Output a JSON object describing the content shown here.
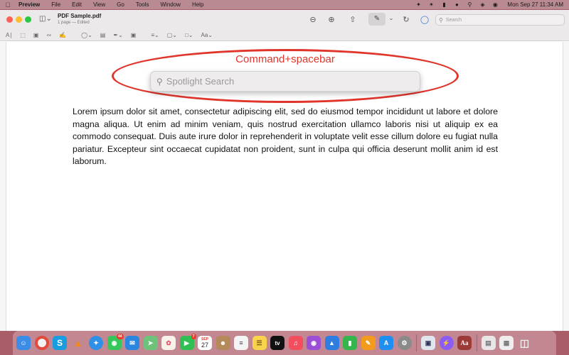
{
  "menubar": {
    "app_name": "Preview",
    "items": [
      "File",
      "Edit",
      "View",
      "Go",
      "Tools",
      "Window",
      "Help"
    ],
    "clock": "Mon Sep 27  11:34 AM"
  },
  "window": {
    "doc_title": "PDF Sample.pdf",
    "doc_subtitle": "1 page — Edited",
    "search_placeholder": "Search"
  },
  "annotation": {
    "label": "Command+spacebar",
    "color": "#e0352b"
  },
  "spotlight": {
    "placeholder": "Spotlight Search"
  },
  "document": {
    "body": "Lorem ipsum dolor sit amet, consectetur adipiscing elit, sed do eiusmod tempor incididunt ut labore et dolore magna aliqua. Ut enim ad minim veniam, quis nostrud exercitation ullamco laboris nisi ut aliquip ex ea commodo consequat. Duis aute irure dolor in reprehenderit in voluptate velit esse cillum dolore eu fugiat nulla pariatur. Excepteur sint occaecat cupidatat non proident, sunt in culpa qui officia deserunt mollit anim id est laborum."
  },
  "dock": {
    "messages_badge": "44",
    "facetime_badge": "7",
    "calendar_month": "SEP",
    "calendar_day": "27",
    "appletv_label": "tv",
    "dictionary_label": "Aa"
  }
}
